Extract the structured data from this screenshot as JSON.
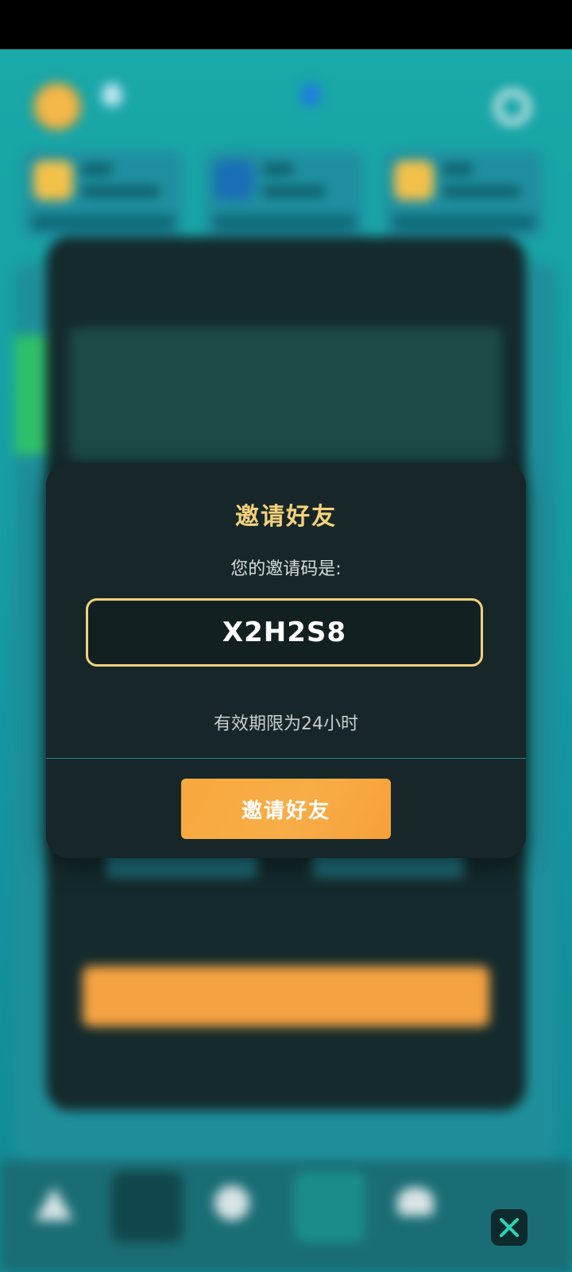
{
  "dialog": {
    "title": "邀请好友",
    "subtitle": "您的邀请码是:",
    "invite_code": "X2H2S8",
    "validity_text": "有效期限为24小时",
    "button_label": "邀请好友"
  },
  "colors": {
    "accent_gold": "#f4d27a",
    "button_orange": "#f7a83e",
    "dialog_bg": "#172729"
  },
  "icons": {
    "close": "close-icon"
  }
}
